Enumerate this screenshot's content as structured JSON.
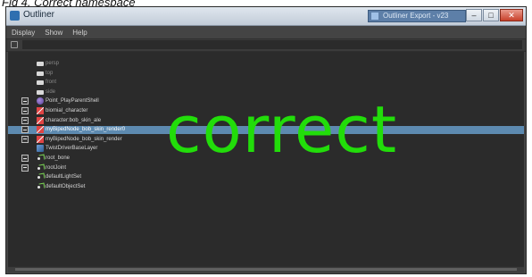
{
  "caption": "Fig 4. Correct namespace",
  "window": {
    "title": "Outliner",
    "background_task": "Outliner Export - v23"
  },
  "menu": [
    "Display",
    "Show",
    "Help"
  ],
  "tree": [
    {
      "label": "persp",
      "icon": "camera-icon",
      "expandable": false,
      "selected": false,
      "dim": true
    },
    {
      "label": "top",
      "icon": "camera-icon",
      "expandable": false,
      "selected": false,
      "dim": true
    },
    {
      "label": "front",
      "icon": "camera-icon",
      "expandable": false,
      "selected": false,
      "dim": true
    },
    {
      "label": "side",
      "icon": "camera-icon",
      "expandable": false,
      "selected": false,
      "dim": true
    },
    {
      "label": "Point_PlayParentShell",
      "icon": "set-icon",
      "expandable": true,
      "selected": false,
      "dim": false
    },
    {
      "label": "biomial_character",
      "icon": "reference-icon",
      "expandable": true,
      "selected": false,
      "dim": false
    },
    {
      "label": "character:bob_skin_ale",
      "icon": "reference-icon",
      "expandable": true,
      "selected": false,
      "dim": false
    },
    {
      "label": "myBipedNode_bob_skin_render0",
      "icon": "reference-icon",
      "expandable": true,
      "selected": true,
      "dim": false
    },
    {
      "label": "myBipedNode_bob_skin_render",
      "icon": "reference-icon",
      "expandable": true,
      "selected": false,
      "dim": false
    },
    {
      "label": "TwistDriverBaseLayer",
      "icon": "clip-icon",
      "expandable": false,
      "selected": false,
      "dim": false
    },
    {
      "label": "root_bone",
      "icon": "joint-icon",
      "expandable": true,
      "selected": false,
      "dim": false
    },
    {
      "label": "rootJoint",
      "icon": "joint-icon",
      "expandable": true,
      "selected": false,
      "dim": false
    },
    {
      "label": "defaultLightSet",
      "icon": "joint-icon",
      "expandable": false,
      "selected": false,
      "dim": false
    },
    {
      "label": "defaultObjectSet",
      "icon": "joint-icon",
      "expandable": false,
      "selected": false,
      "dim": false
    }
  ],
  "overlay_text": "correct",
  "colors": {
    "overlay": "#22dd0a",
    "selection": "#5d8ab0",
    "panel": "#2b2b2b"
  }
}
